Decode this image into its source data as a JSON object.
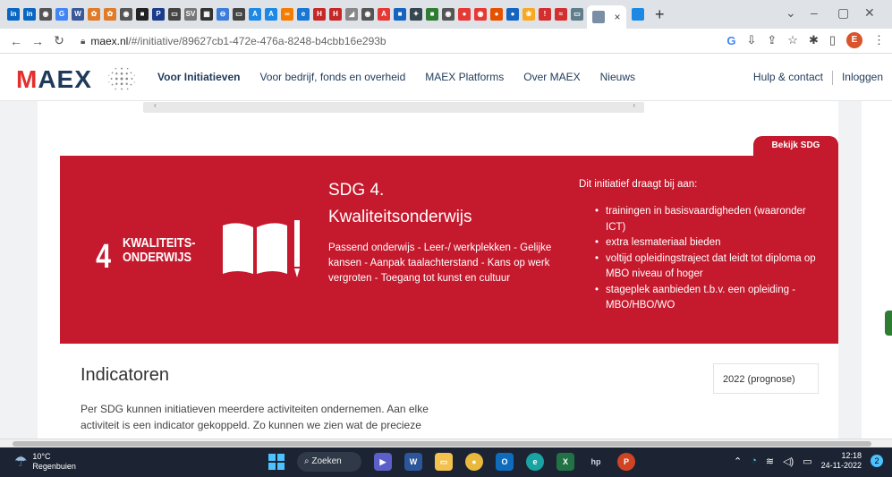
{
  "browser": {
    "tab_favicons": [
      {
        "label": "in",
        "color": "#0a66c2"
      },
      {
        "label": "in",
        "color": "#0a66c2"
      },
      {
        "label": "◉",
        "color": "#555555"
      },
      {
        "label": "G",
        "color": "#4285f4"
      },
      {
        "label": "W",
        "color": "#3b5998"
      },
      {
        "label": "✿",
        "color": "#e07b2a"
      },
      {
        "label": "✿",
        "color": "#e07b2a"
      },
      {
        "label": "◉",
        "color": "#555555"
      },
      {
        "label": "■",
        "color": "#222222"
      },
      {
        "label": "P",
        "color": "#1a3c8a"
      },
      {
        "label": "▭",
        "color": "#444444"
      },
      {
        "label": "SV",
        "color": "#777777"
      },
      {
        "label": "▦",
        "color": "#333333"
      },
      {
        "label": "⊖",
        "color": "#3b7dd8"
      },
      {
        "label": "▭",
        "color": "#444444"
      },
      {
        "label": "A",
        "color": "#1e88e5"
      },
      {
        "label": "A",
        "color": "#1e88e5"
      },
      {
        "label": "∞",
        "color": "#f57c00"
      },
      {
        "label": "e",
        "color": "#1976d2"
      },
      {
        "label": "H",
        "color": "#c62828"
      },
      {
        "label": "H",
        "color": "#c62828"
      },
      {
        "label": "◢",
        "color": "#888888"
      },
      {
        "label": "◉",
        "color": "#555555"
      },
      {
        "label": "A",
        "color": "#e53935"
      },
      {
        "label": "■",
        "color": "#1565c0"
      },
      {
        "label": "✦",
        "color": "#37474f"
      },
      {
        "label": "■",
        "color": "#2e7d32"
      },
      {
        "label": "◉",
        "color": "#555555"
      },
      {
        "label": "●",
        "color": "#e53935"
      },
      {
        "label": "◉",
        "color": "#e53935"
      },
      {
        "label": "●",
        "color": "#e65100"
      },
      {
        "label": "●",
        "color": "#1565c0"
      },
      {
        "label": "❀",
        "color": "#f9a825"
      },
      {
        "label": "!",
        "color": "#d32f2f"
      },
      {
        "label": "≈",
        "color": "#d32f2f"
      },
      {
        "label": "▭",
        "color": "#607d8b"
      }
    ],
    "active_tab_close": "×",
    "new_tab": "+",
    "url_host": "maex.nl",
    "url_path": "/#/initiative/89627cb1-472e-476a-8248-b4cbb16e293b",
    "profile_initial": "E",
    "window_controls": [
      "⌄",
      "–",
      "▢",
      "✕"
    ]
  },
  "site": {
    "logo_text": "AEX",
    "logo_m": "M",
    "nav": [
      "Voor Initiatieven",
      "Voor bedrijf, fonds en overheid",
      "MAEX Platforms",
      "Over MAEX",
      "Nieuws"
    ],
    "help": "Hulp & contact",
    "login": "Inloggen"
  },
  "sdg": {
    "tab_label": "Bekijk SDG",
    "number": "4",
    "label_line1": "KWALITEITS-",
    "label_line2": "ONDERWIJS",
    "title_line1": "SDG 4.",
    "title_line2": "Kwaliteitsonderwijs",
    "description": "Passend onderwijs - Leer-/ werkplekken - Gelijke kansen - Aanpak taalachterstand - Kans op werk vergroten - Toegang tot kunst en cultuur",
    "contrib_title": "Dit initiatief draagt bij aan:",
    "contributions": [
      "trainingen in basisvaardigheden (waaronder ICT)",
      "extra lesmateriaal bieden",
      "voltijd opleidingstraject dat leidt tot diploma op MBO niveau of hoger",
      "stageplek aanbieden t.b.v. een opleiding - MBO/HBO/WO"
    ],
    "color": "#c5192d"
  },
  "indicators": {
    "title": "Indicatoren",
    "text": "Per SDG kunnen initiatieven meerdere activiteiten ondernemen. Aan elke activiteit is een indicator gekoppeld. Zo kunnen we zien wat de precieze",
    "year_select": "2022 (prognose)"
  },
  "taskbar": {
    "temp": "10°C",
    "weather": "Regenbuien",
    "search": "Zoeken",
    "time": "12:18",
    "date": "24-11-2022",
    "notifications": "2"
  }
}
